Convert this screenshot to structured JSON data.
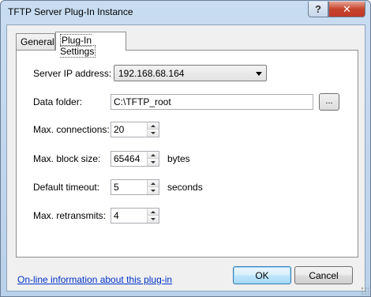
{
  "window": {
    "title": "TFTP Server Plug-In Instance",
    "help_label": "?",
    "close_label": "✕"
  },
  "tabs": [
    {
      "label": "General",
      "selected": false
    },
    {
      "label": "Plug-In Settings",
      "selected": true
    }
  ],
  "settings": {
    "server_ip": {
      "label": "Server IP address:",
      "value": "192.168.68.164"
    },
    "data_folder": {
      "label": "Data folder:",
      "value": "C:\\TFTP_root",
      "browse_label": "..."
    },
    "max_connections": {
      "label": "Max. connections:",
      "value": "20"
    },
    "max_block_size": {
      "label": "Max. block size:",
      "value": "65464",
      "unit": "bytes"
    },
    "default_timeout": {
      "label": "Default timeout:",
      "value": "5",
      "unit": "seconds"
    },
    "max_retransmits": {
      "label": "Max. retransmits:",
      "value": "4"
    }
  },
  "footer": {
    "info_link": "On-line information about this plug-in",
    "ok_label": "OK",
    "cancel_label": "Cancel"
  },
  "colors": {
    "title_bar": "#c9dcf1",
    "close_button": "#c7442c",
    "link": "#0033cc",
    "ok_button_border": "#3c7fb1"
  }
}
